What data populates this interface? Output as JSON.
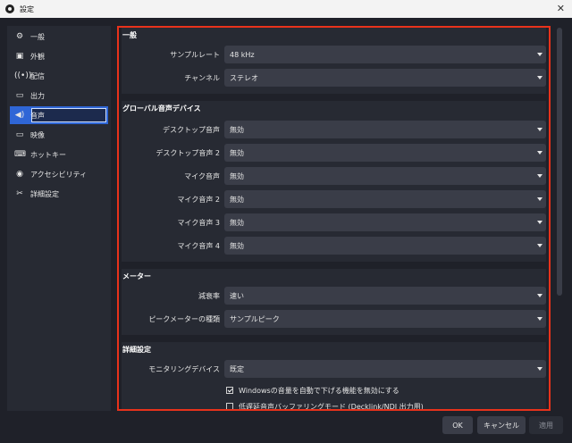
{
  "window": {
    "title": "設定"
  },
  "sidebar": {
    "items": [
      {
        "label": "一般",
        "icon": "gear-icon"
      },
      {
        "label": "外観",
        "icon": "appearance-icon"
      },
      {
        "label": "配信",
        "icon": "broadcast-icon"
      },
      {
        "label": "出力",
        "icon": "output-icon"
      },
      {
        "label": "音声",
        "icon": "speaker-icon"
      },
      {
        "label": "映像",
        "icon": "monitor-icon"
      },
      {
        "label": "ホットキー",
        "icon": "keyboard-icon"
      },
      {
        "label": "アクセシビリティ",
        "icon": "accessibility-icon"
      },
      {
        "label": "詳細設定",
        "icon": "tools-icon"
      }
    ],
    "active_index": 4
  },
  "general": {
    "title": "一般",
    "sample_rate": {
      "label": "サンプルレート",
      "value": "48 kHz"
    },
    "channels": {
      "label": "チャンネル",
      "value": "ステレオ"
    }
  },
  "global_devices": {
    "title": "グローバル音声デバイス",
    "rows": [
      {
        "label": "デスクトップ音声",
        "value": "無効"
      },
      {
        "label": "デスクトップ音声 2",
        "value": "無効"
      },
      {
        "label": "マイク音声",
        "value": "無効"
      },
      {
        "label": "マイク音声 2",
        "value": "無効"
      },
      {
        "label": "マイク音声 3",
        "value": "無効"
      },
      {
        "label": "マイク音声 4",
        "value": "無効"
      }
    ]
  },
  "meters": {
    "title": "メーター",
    "decay": {
      "label": "減衰率",
      "value": "速い"
    },
    "peak_type": {
      "label": "ピークメーターの種類",
      "value": "サンプルピーク"
    }
  },
  "advanced": {
    "title": "詳細設定",
    "monitoring": {
      "label": "モニタリングデバイス",
      "value": "既定"
    },
    "ducking": {
      "label": "Windowsの音量を自動で下げる機能を無効にする",
      "checked": true
    },
    "low_latency": {
      "label": "低遅延音声バッファリングモード (Decklink/NDI 出力用)",
      "checked": false
    }
  },
  "buttons": {
    "ok": "OK",
    "cancel": "キャンセル",
    "apply": "適用"
  },
  "colors": {
    "accent": "#2f66d6",
    "highlight_border": "#e8321b"
  }
}
